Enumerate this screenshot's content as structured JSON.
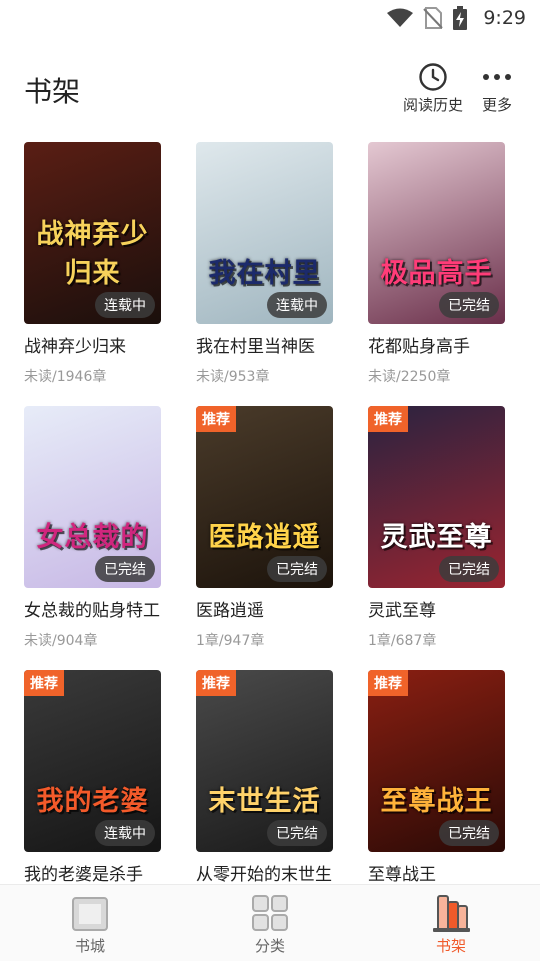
{
  "status_bar": {
    "time": "9:29"
  },
  "header": {
    "title": "书架",
    "history_label": "阅读历史",
    "more_label": "更多"
  },
  "books": [
    {
      "name": "战神弃少归来",
      "progress": "未读/1946章",
      "cover_text": "战神弃少归来",
      "status": "连载中",
      "badge": "",
      "colors": [
        "#5a1e14",
        "#1a0f0c"
      ],
      "title_color": "#f7d25b"
    },
    {
      "name": "我在村里当神医",
      "progress": "未读/953章",
      "cover_text": "我在村里",
      "status": "连载中",
      "badge": "",
      "colors": [
        "#dfe8ec",
        "#9fb5bf"
      ],
      "title_color": "#1c2a6b"
    },
    {
      "name": "花都贴身高手",
      "progress": "未读/2250章",
      "cover_text": "极品高手",
      "status": "已完结",
      "badge": "",
      "colors": [
        "#e4c8d2",
        "#6a2f4a"
      ],
      "title_color": "#ff3c78"
    },
    {
      "name": "女总裁的贴身特工",
      "progress": "未读/904章",
      "cover_text": "女总裁的",
      "status": "已完结",
      "badge": "",
      "colors": [
        "#e7ecf8",
        "#c7b7e5"
      ],
      "title_color": "#d0267e"
    },
    {
      "name": "医路逍遥",
      "progress": "1章/947章",
      "cover_text": "医路逍遥",
      "status": "已完结",
      "badge": "推荐",
      "colors": [
        "#4a3b2a",
        "#1c130b"
      ],
      "title_color": "#ffd34a"
    },
    {
      "name": "灵武至尊",
      "progress": "1章/687章",
      "cover_text": "灵武至尊",
      "status": "已完结",
      "badge": "推荐",
      "colors": [
        "#2a2340",
        "#9a2430"
      ],
      "title_color": "#ffffff"
    },
    {
      "name": "我的老婆是杀手",
      "progress": "",
      "cover_text": "我的老婆",
      "status": "连载中",
      "badge": "推荐",
      "colors": [
        "#3a3a3a",
        "#151515"
      ],
      "title_color": "#f35a2a"
    },
    {
      "name": "从零开始的末世生",
      "progress": "",
      "cover_text": "末世生活",
      "status": "已完结",
      "badge": "推荐",
      "colors": [
        "#4a4a4a",
        "#1a1a1a"
      ],
      "title_color": "#ffd26a"
    },
    {
      "name": "至尊战王",
      "progress": "",
      "cover_text": "至尊战王",
      "status": "已完结",
      "badge": "推荐",
      "colors": [
        "#8a1f12",
        "#2a0a06"
      ],
      "title_color": "#ffb23a"
    }
  ],
  "tabbar": {
    "tabs": [
      {
        "label": "书城",
        "icon": "bookstore-icon"
      },
      {
        "label": "分类",
        "icon": "category-icon"
      },
      {
        "label": "书架",
        "icon": "bookshelf-icon"
      }
    ],
    "active": 2,
    "accent": "#f05a2a"
  }
}
